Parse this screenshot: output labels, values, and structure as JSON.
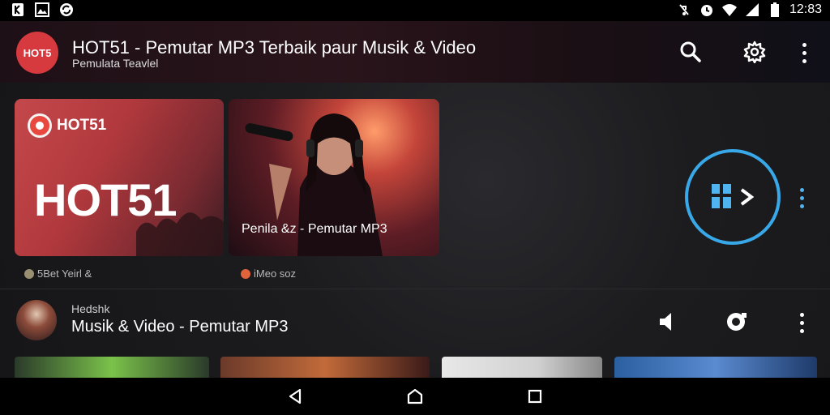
{
  "status_bar": {
    "time": "12:83",
    "left_icons": [
      "notification-app-icon",
      "gallery-icon",
      "sync-icon"
    ],
    "right_icons": [
      "mute-icon",
      "alarm-icon",
      "wifi-icon",
      "signal-icon",
      "battery-icon"
    ]
  },
  "app_bar": {
    "logo_text": "HOT5",
    "title": "HOT51 - Pemutar MP3 Terbaik paur Musik & Video",
    "subtitle": "Pemulata Teavlel",
    "actions": [
      "search-icon",
      "settings-gear-icon",
      "more-vert-icon"
    ]
  },
  "featured": [
    {
      "badge_text": "HOT51",
      "headline": "HOT51",
      "meta": "5Bet Yeirl &"
    },
    {
      "caption": "Penila &z - Pemutar MP3",
      "meta": "iMeo soz"
    }
  ],
  "now_playing": {
    "label": "Hedshk",
    "title": "Musik & Video - Pemutar MP3",
    "controls": [
      "volume-icon",
      "record-icon",
      "more-vert-icon"
    ]
  },
  "thumbnails": [
    "green-thumb",
    "band-thumb",
    "poster-thumb",
    "stage-thumb"
  ],
  "nav": [
    "back-icon",
    "home-icon",
    "recents-icon"
  ],
  "colors": {
    "accent": "#38a8e8",
    "brand_red": "#d63a3f",
    "background": "#1c1c1f"
  }
}
